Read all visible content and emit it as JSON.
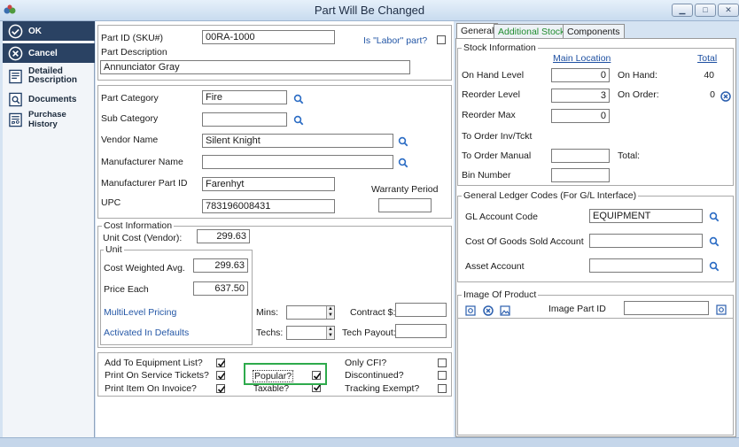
{
  "window": {
    "title": "Part Will Be Changed"
  },
  "sidebar": {
    "ok": "OK",
    "cancel": "Cancel",
    "detailed_description": "Detailed Description",
    "documents": "Documents",
    "purchase_history": "Purchase History"
  },
  "part": {
    "id_label": "Part ID (SKU#)",
    "id_value": "00RA-1000",
    "is_labor_label": "Is \"Labor\" part?",
    "description_label": "Part Description",
    "description_value": "Annunciator Gray"
  },
  "details": {
    "category_label": "Part Category",
    "category_value": "Fire",
    "sub_category_label": "Sub Category",
    "sub_category_value": "",
    "vendor_label": "Vendor Name",
    "vendor_value": "Silent Knight",
    "manufacturer_label": "Manufacturer Name",
    "manufacturer_value": "",
    "mfr_part_id_label": "Manufacturer Part ID",
    "mfr_part_id_value": "Farenhyt",
    "warranty_label": "Warranty Period",
    "warranty_value": "",
    "upc_label": "UPC",
    "upc_value": "783196008431"
  },
  "cost": {
    "title": "Cost Information",
    "unit_cost_label": "Unit Cost (Vendor):",
    "unit_cost_value": "299.63",
    "unit_title": "Unit",
    "cost_weighted_label": "Cost Weighted Avg.",
    "cost_weighted_value": "299.63",
    "price_each_label": "Price Each",
    "price_each_value": "637.50",
    "multilevel_label": "MultiLevel Pricing",
    "activated_label": "Activated In Defaults",
    "mins_label": "Mins:",
    "techs_label": "Techs:",
    "contract_label": "Contract $:",
    "tech_payout_label": "Tech Payout:"
  },
  "flags": {
    "add_equipment": "Add To Equipment List?",
    "print_service": "Print On Service Tickets?",
    "print_invoice": "Print Item On Invoice?",
    "popular": "Popular?",
    "taxable": "Taxable?",
    "only_cfi": "Only CFI?",
    "discontinued": "Discontinued?",
    "tracking_exempt": "Tracking Exempt?"
  },
  "tabs": {
    "general": "General",
    "additional_stock": "Additional Stock",
    "components": "Components"
  },
  "stock": {
    "title": "Stock Information",
    "main_location": "Main Location",
    "total": "Total",
    "on_hand_label": "On Hand Level",
    "on_hand_value": "0",
    "on_hand_total_label": "On Hand:",
    "on_hand_total_value": "40",
    "reorder_level_label": "Reorder Level",
    "reorder_level_value": "3",
    "on_order_label": "On Order:",
    "on_order_value": "0",
    "reorder_max_label": "Reorder Max",
    "reorder_max_value": "0",
    "to_order_inv_label": "To Order Inv/Tckt",
    "to_order_manual_label": "To Order Manual",
    "total_label": "Total:",
    "bin_label": "Bin Number"
  },
  "gl": {
    "title": "General Ledger Codes (For G/L Interface)",
    "account_label": "GL Account Code",
    "account_value": "EQUIPMENT",
    "cogs_label": "Cost Of Goods Sold Account",
    "asset_label": "Asset Account"
  },
  "image": {
    "title": "Image Of Product",
    "part_id_label": "Image Part ID"
  }
}
